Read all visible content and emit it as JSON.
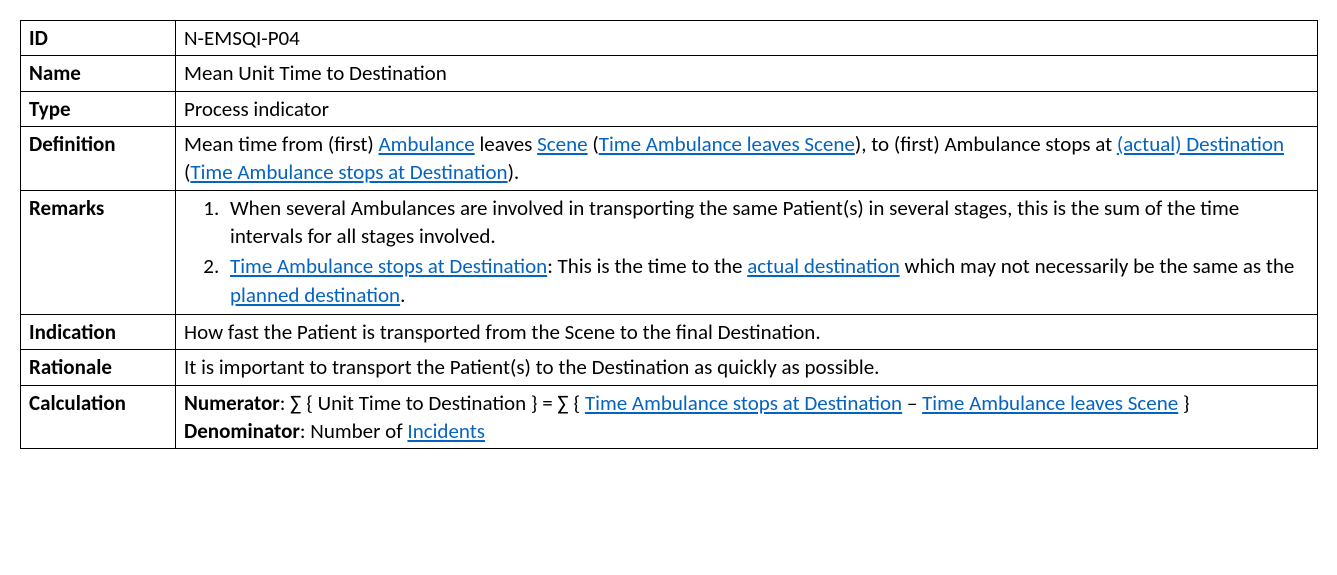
{
  "rows": {
    "id": {
      "label": "ID",
      "value": "N-EMSQI-P04"
    },
    "name": {
      "label": "Name",
      "value": "Mean Unit Time to Destination"
    },
    "type": {
      "label": "Type",
      "value": "Process indicator"
    },
    "definition": {
      "label": "Definition"
    },
    "remarks": {
      "label": "Remarks"
    },
    "indication": {
      "label": "Indication",
      "value": "How fast the Patient is transported from the Scene to the final Destination."
    },
    "rationale": {
      "label": "Rationale",
      "value": "It is important to transport the Patient(s) to the Destination as quickly as possible."
    },
    "calculation": {
      "label": "Calculation"
    }
  },
  "definition": {
    "t0": "Mean time from (first) ",
    "l0": "Ambulance",
    "t1": " leaves ",
    "l1": "Scene",
    "t2": " (",
    "l2": "Time Ambulance leaves Scene",
    "t3": "), to (first) Ambulance stops at ",
    "l3": "(actual) Destination",
    "t4": " (",
    "l4": "Time Ambulance stops at Destination",
    "t5": ")."
  },
  "remarks": {
    "item1": "When several Ambulances are involved in transporting the same Patient(s) in several stages, this is the sum of the time intervals for all stages involved.",
    "item2": {
      "l0": "Time Ambulance stops at Destination",
      "t0": ": This is the time to the ",
      "l1": "actual destination",
      "t1": " which may not necessarily be the same as the ",
      "l2": "planned destination",
      "t2": "."
    }
  },
  "calculation": {
    "numerator_label": "Numerator",
    "num_t0": ": ∑ { Unit Time to Destination } = ∑ { ",
    "num_l0": "Time Ambulance stops at Destination",
    "num_t1": " – ",
    "num_l1": "Time Ambulance leaves Scene",
    "num_t2": " }",
    "denominator_label": "Denominator",
    "den_t0": ": Number of ",
    "den_l0": "Incidents"
  }
}
